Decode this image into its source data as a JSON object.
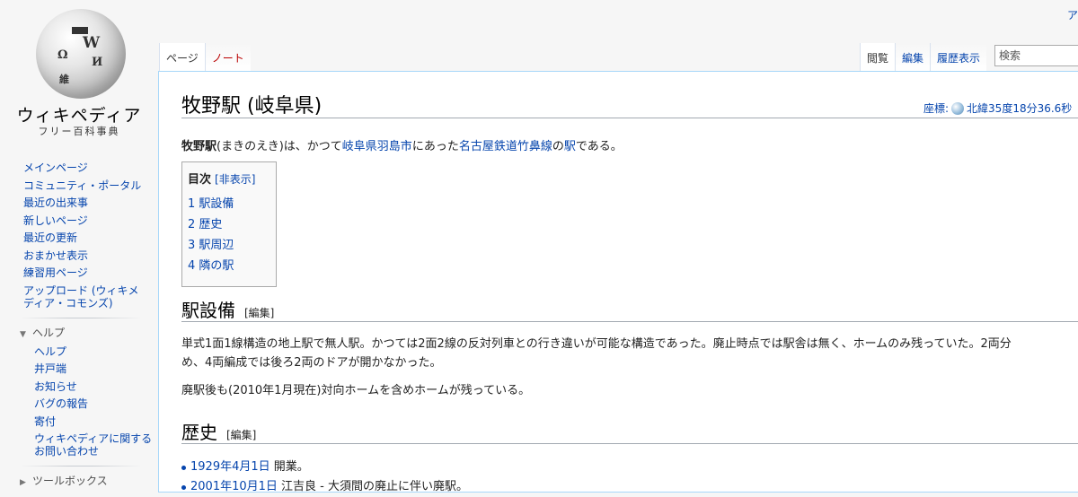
{
  "personal": {
    "text": "ア"
  },
  "logo": {
    "wordmark": "ウィキペディア",
    "tagline": "フリー百科事典"
  },
  "sidebar": {
    "navigation": [
      "メインページ",
      "コミュニティ・ポータル",
      "最近の出来事",
      "新しいページ",
      "最近の更新",
      "おまかせ表示",
      "練習用ページ"
    ],
    "upload": "アップロード (ウィキメディア・コモンズ)",
    "help_heading": "ヘルプ",
    "help_items": [
      "ヘルプ",
      "井戸端",
      "お知らせ",
      "バグの報告",
      "寄付"
    ],
    "help_contact": "ウィキペディアに関するお問い合わせ",
    "toolbox_heading": "ツールボックス"
  },
  "tabs": {
    "left": [
      {
        "label": "ページ",
        "selected": true
      },
      {
        "label": "ノート",
        "redlink": true
      }
    ],
    "right": [
      {
        "label": "閲覧",
        "selected": true
      },
      {
        "label": "編集"
      },
      {
        "label": "履歴表示"
      }
    ]
  },
  "search": {
    "placeholder": "検索"
  },
  "article": {
    "title": "牧野駅 (岐阜県)",
    "coord_label": "座標:",
    "coord_value": "北緯35度18分36.6秒",
    "lead": {
      "bold": "牧野駅",
      "t1": "(まきのえき)は、かつて",
      "link1": "岐阜県",
      "link2": "羽島市",
      "t2": "にあった",
      "link3": "名古屋鉄道",
      "link4": "竹鼻線",
      "t3": "の",
      "link5": "駅",
      "t4": "である。"
    },
    "toc": {
      "title": "目次",
      "toggle": "[非表示]",
      "items": [
        "1 駅設備",
        "2 歴史",
        "3 駅周辺",
        "4 隣の駅"
      ]
    },
    "section1": {
      "heading": "駅設備",
      "edit": "[編集]",
      "p1_line1": "単式1面1線構造の地上駅で無人駅。かつては2面2線の反対列車との行き違いが可能な構造であった。廃止時点では駅舎は無く、ホームのみ残っていた。2両分",
      "p1_line2": "め、4両編成では後ろ2両のドアが開かなかった。",
      "p2": "廃駅後も(2010年1月現在)対向ホームを含めホームが残っている。"
    },
    "section2": {
      "heading": "歴史",
      "edit": "[編集]",
      "item1_date": "1929年4月1日",
      "item1_text": "開業。",
      "item2_date": "2001年10月1日",
      "item2_text": "江吉良 - 大須間の廃止に伴い廃駅。"
    }
  }
}
